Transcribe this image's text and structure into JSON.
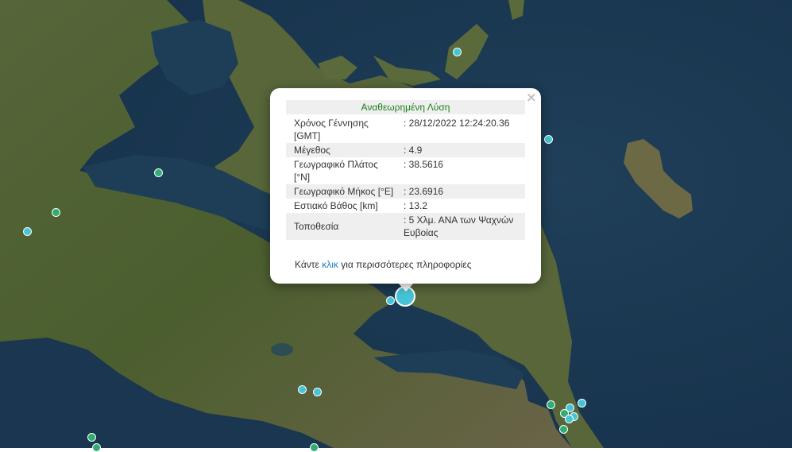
{
  "popup": {
    "title": "Αναθεωρημένη Λύση",
    "close": "×",
    "rows": [
      {
        "label": "Χρόνος Γέννησης [GMT]",
        "value": ": 28/12/2022 12:24:20.36"
      },
      {
        "label": "Μέγεθος",
        "value": ": 4.9"
      },
      {
        "label": "Γεωγραφικό Πλάτος [°N]",
        "value": ": 38.5616"
      },
      {
        "label": "Γεωγραφικό Μήκος [°E]",
        "value": ": 23.6916"
      },
      {
        "label": "Εστιακό Βάθος [km]",
        "value": ": 13.2"
      },
      {
        "label": "Τοποθεσία",
        "value": ": 5 Χλμ. ΑΝΑ των Ψαχνών Ευβοίας"
      }
    ],
    "more_prefix": "Κάντε ",
    "more_link": "κλικ",
    "more_suffix": " για περισσότερες πληροφορίες"
  },
  "colors": {
    "sea": "#1d3a52",
    "land": "#4f6230",
    "recent_marker": "#46c4d6",
    "older_marker": "#2fae73",
    "title_text": "#1a7f1a",
    "link": "#1f7fc0"
  }
}
